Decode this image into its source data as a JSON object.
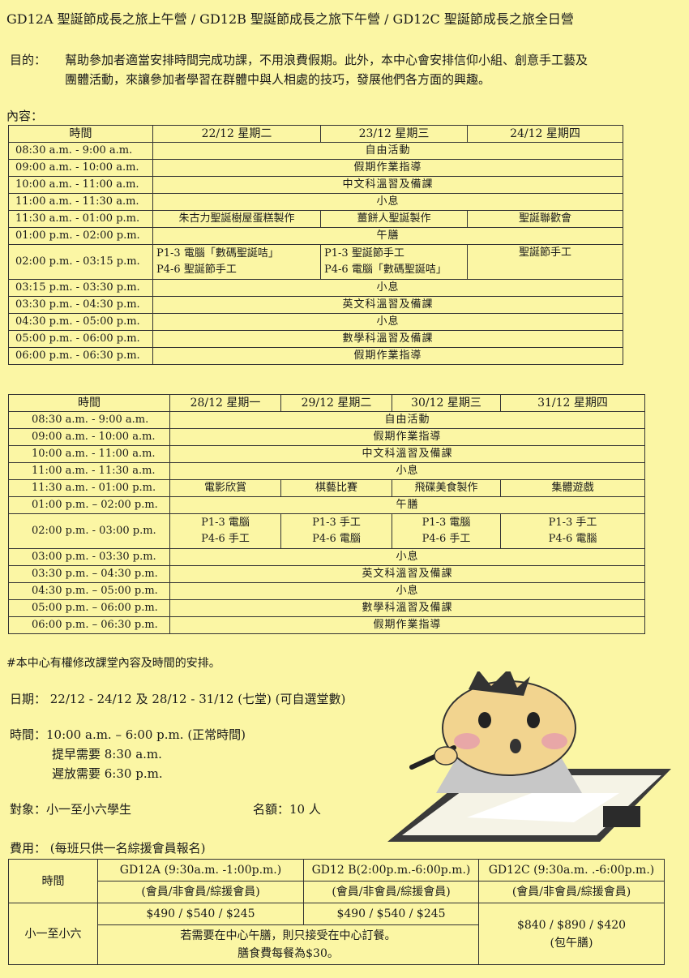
{
  "title": "GD12A 聖誕節成長之旅上午營 / GD12B 聖誕節成長之旅下午營 / GD12C 聖誕節成長之旅全日營",
  "purpose": {
    "label": "目的：",
    "line1": "幫助參加者適當安排時間完成功課，不用浪費假期。此外，本中心會安排信仰小組、創意手工藝及",
    "line2": "團體活動，來讓參加者學習在群體中與人相處的技巧，發展他們各方面的興趣。"
  },
  "content_label": "內容：",
  "schedule1": {
    "header_time": "時間",
    "days": [
      "22/12 星期二",
      "23/12 星期三",
      "24/12 星期四"
    ],
    "rows": {
      "r1": {
        "time": "08:30 a.m. - 9:00 a.m.",
        "all": "自由活動"
      },
      "r2": {
        "time": "09:00 a.m. - 10:00 a.m.",
        "all": "假期作業指導"
      },
      "r3": {
        "time": "10:00 a.m. - 11:00 a.m.",
        "all": "中文科溫習及備課"
      },
      "r4": {
        "time": "11:00 a.m. - 11:30 a.m.",
        "all": "小息"
      },
      "r5": {
        "time": "11:30 a.m. - 01:00 p.m.",
        "d1": "朱古力聖誕樹屋蛋糕製作",
        "d2": "薑餅人聖誕製作",
        "d3": "聖誕聯歡會"
      },
      "r6": {
        "time": "01:00 p.m. - 02:00 p.m.",
        "all": "午膳"
      },
      "r7": {
        "time": "02:00 p.m. - 03:15 p.m.",
        "d1a": "P1-3 電腦「數碼聖誕咭」",
        "d1b": "P4-6 聖誕節手工",
        "d2a": "P1-3 聖誕節手工",
        "d2b": "P4-6 電腦「數碼聖誕咭」",
        "d3": "聖誕節手工"
      },
      "r8": {
        "time": "03:15 p.m. - 03:30 p.m.",
        "all": "小息"
      },
      "r9": {
        "time": "03:30 p.m. - 04:30 p.m.",
        "all": "英文科溫習及備課"
      },
      "r10": {
        "time": "04:30 p.m. - 05:00 p.m.",
        "all": "小息"
      },
      "r11": {
        "time": "05:00 p.m. - 06:00 p.m.",
        "all": "數學科溫習及備課"
      },
      "r12": {
        "time": "06:00 p.m. - 06:30 p.m.",
        "all": "假期作業指導"
      }
    }
  },
  "schedule2": {
    "header_time": "時間",
    "days": [
      "28/12 星期一",
      "29/12 星期二",
      "30/12 星期三",
      "31/12 星期四"
    ],
    "rows": {
      "r1": {
        "time": "08:30 a.m. - 9:00 a.m.",
        "all": "自由活動"
      },
      "r2": {
        "time": "09:00 a.m. - 10:00 a.m.",
        "all": "假期作業指導"
      },
      "r3": {
        "time": "10:00 a.m. - 11:00 a.m.",
        "all": "中文科溫習及備課"
      },
      "r4": {
        "time": "11:00 a.m. - 11:30 a.m.",
        "all": "小息"
      },
      "r5": {
        "time": "11:30 a.m. - 01:00 p.m.",
        "d1": "電影欣賞",
        "d2": "棋藝比賽",
        "d3": "飛碟美食製作",
        "d4": "集體遊戲"
      },
      "r6": {
        "time": "01:00 p.m. – 02:00 p.m.",
        "all": "午膳"
      },
      "r7": {
        "time": "02:00 p.m. - 03:00 p.m.",
        "d1a": "P1-3 電腦",
        "d1b": "P4-6 手工",
        "d2a": "P1-3 手工",
        "d2b": "P4-6 電腦",
        "d3a": "P1-3 電腦",
        "d3b": "P4-6 手工",
        "d4a": "P1-3 手工",
        "d4b": "P4-6 電腦"
      },
      "r8": {
        "time": "03:00 p.m. - 03:30 p.m.",
        "all": "小息"
      },
      "r9": {
        "time": "03:30 p.m. – 04:30 p.m.",
        "all": "英文科溫習及備課"
      },
      "r10": {
        "time": "04:30 p.m. – 05:00 p.m.",
        "all": "小息"
      },
      "r11": {
        "time": "05:00 p.m. – 06:00 p.m.",
        "all": "數學科溫習及備課"
      },
      "r12": {
        "time": "06:00 p.m. – 06:30 p.m.",
        "all": "假期作業指導"
      }
    }
  },
  "note": "#本中心有權修改課堂內容及時間的安排。",
  "date": "日期： 22/12 - 24/12 及 28/12 - 31/12 (七堂) (可自選堂數)",
  "time": {
    "line1": "時間：10:00 a.m. – 6:00 p.m. (正常時間)",
    "line2": "提早需要 8:30 a.m.",
    "line3": "遲放需要 6:30 p.m."
  },
  "target": "對象：小一至小六學生",
  "quota": "名額：10 人",
  "fee_label": "費用： (每班只供一名綜援會員報名)",
  "fees": {
    "header_time": "時間",
    "a_title": "GD12A (9:30a.m. -1:00p.m.)",
    "a_sub": "(會員/非會員/綜援會員)",
    "b_title": "GD12 B(2:00p.m.-6:00p.m.)",
    "b_sub": "(會員/非會員/綜援會員)",
    "c_title": "GD12C (9:30a.m. .-6:00p.m.)",
    "c_sub": "(會員/非會員/綜援會員)",
    "row_label": "小一至小六",
    "a_price": "$490 / $540 / $245",
    "b_price": "$490 / $540 / $245",
    "lunch1": "若需要在中心午膳，則只接受在中心訂餐。",
    "lunch2": "膳食費每餐為$30。",
    "c_price": "$840 / $890 / $420",
    "c_note": "(包午膳)"
  }
}
